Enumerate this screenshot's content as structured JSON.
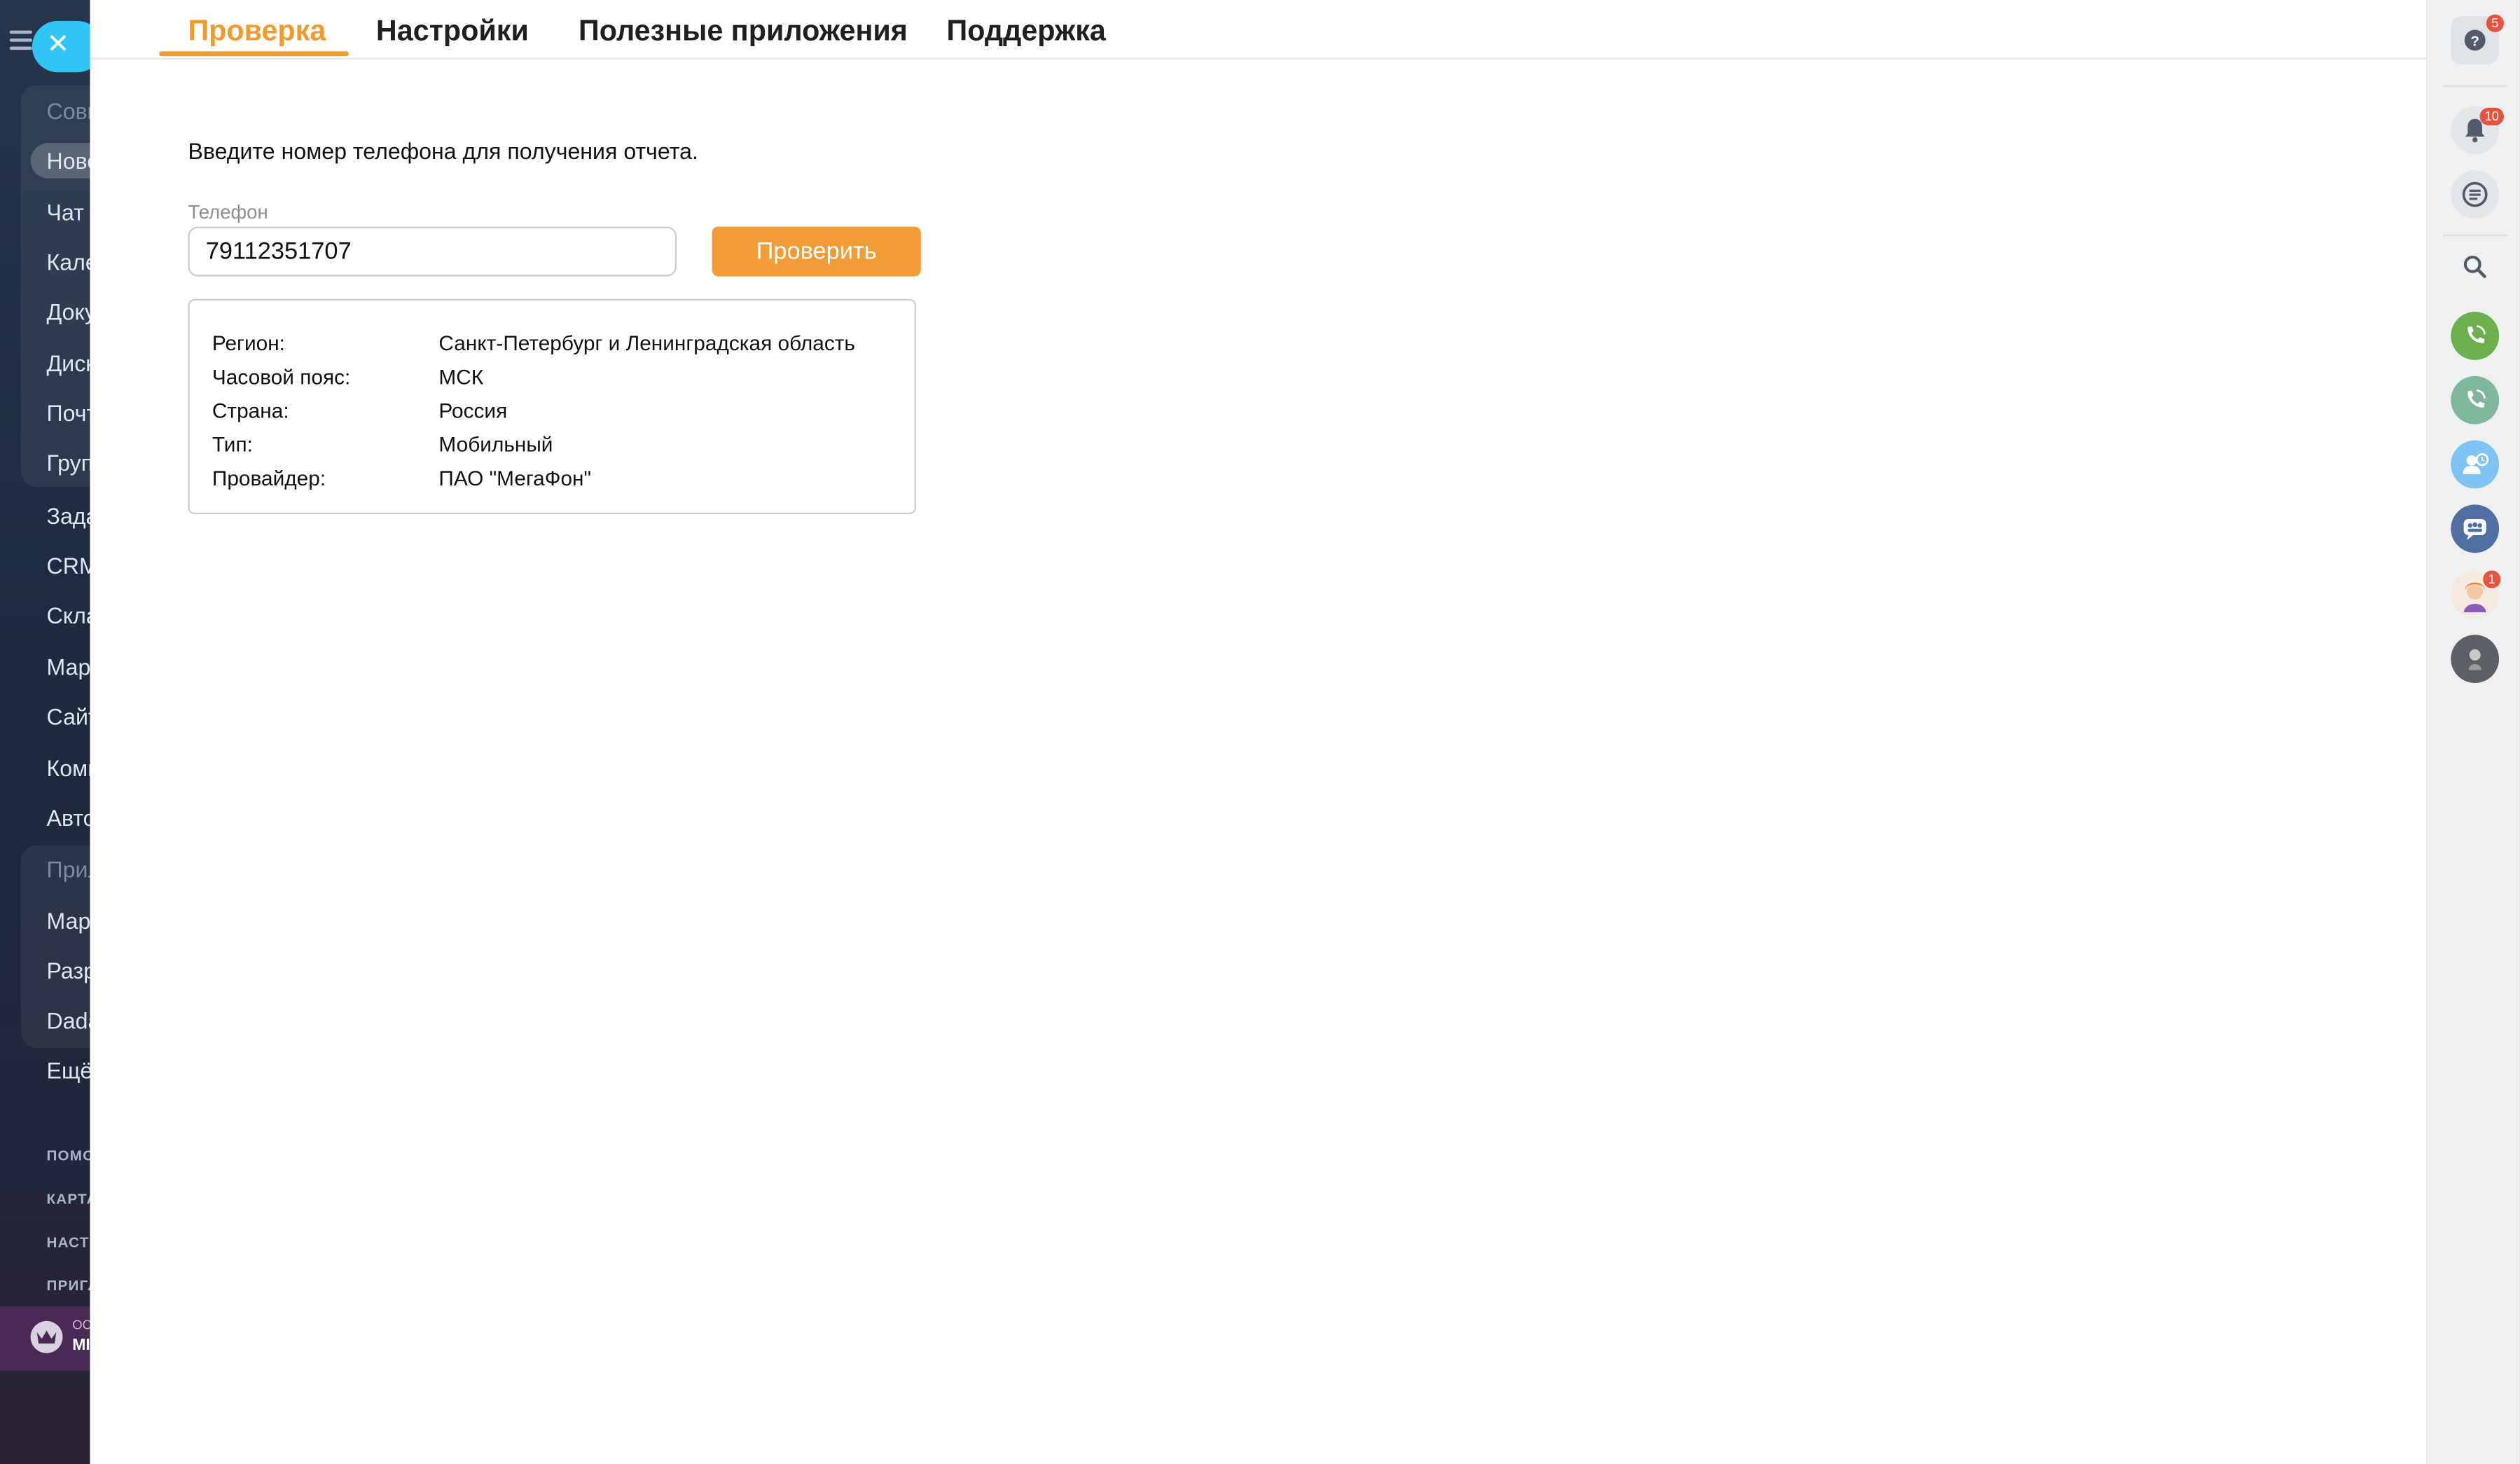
{
  "tabs": [
    {
      "label": "Проверка",
      "active": true
    },
    {
      "label": "Настройки",
      "active": false
    },
    {
      "label": "Полезные приложения",
      "active": false
    },
    {
      "label": "Поддержка",
      "active": false
    }
  ],
  "form": {
    "intro": "Введите номер телефона для получения отчета.",
    "phone_label": "Телефон",
    "phone_value": "79112351707",
    "submit_label": "Проверить"
  },
  "result": [
    {
      "key": "Регион:",
      "value": "Санкт-Петербург и Ленинградская область"
    },
    {
      "key": "Часовой пояс:",
      "value": "МСК"
    },
    {
      "key": "Страна:",
      "value": "Россия"
    },
    {
      "key": "Тип:",
      "value": "Мобильный"
    },
    {
      "key": "Провайдер:",
      "value": "ПАО \"МегаФон\""
    }
  ],
  "sidebar": {
    "items": [
      "Совм",
      "Ново",
      "Чат",
      "Кале",
      "Доку",
      "Диск",
      "Почт",
      "Груп",
      "Зада",
      "CRM",
      "Скла",
      "Марк",
      "Сайт",
      "Комм",
      "Авто",
      "Прил",
      "Марк",
      "Разр",
      "Dada",
      "Ещё"
    ],
    "small_items": [
      "ПОМО",
      "КАРТА",
      "НАСТ",
      "ПРИГЛ"
    ],
    "footer_line1": "ОС",
    "footer_line2": "МІ"
  },
  "right_rail": {
    "help_badge": "5",
    "notifications_badge": "10",
    "avatar_badge": "1"
  },
  "colors": {
    "accent": "#f09b2b",
    "button": "#f19c36",
    "sidebar_bg": "#1d2b44",
    "close_bubble": "#2fc6f6",
    "badge": "#e9533e"
  }
}
